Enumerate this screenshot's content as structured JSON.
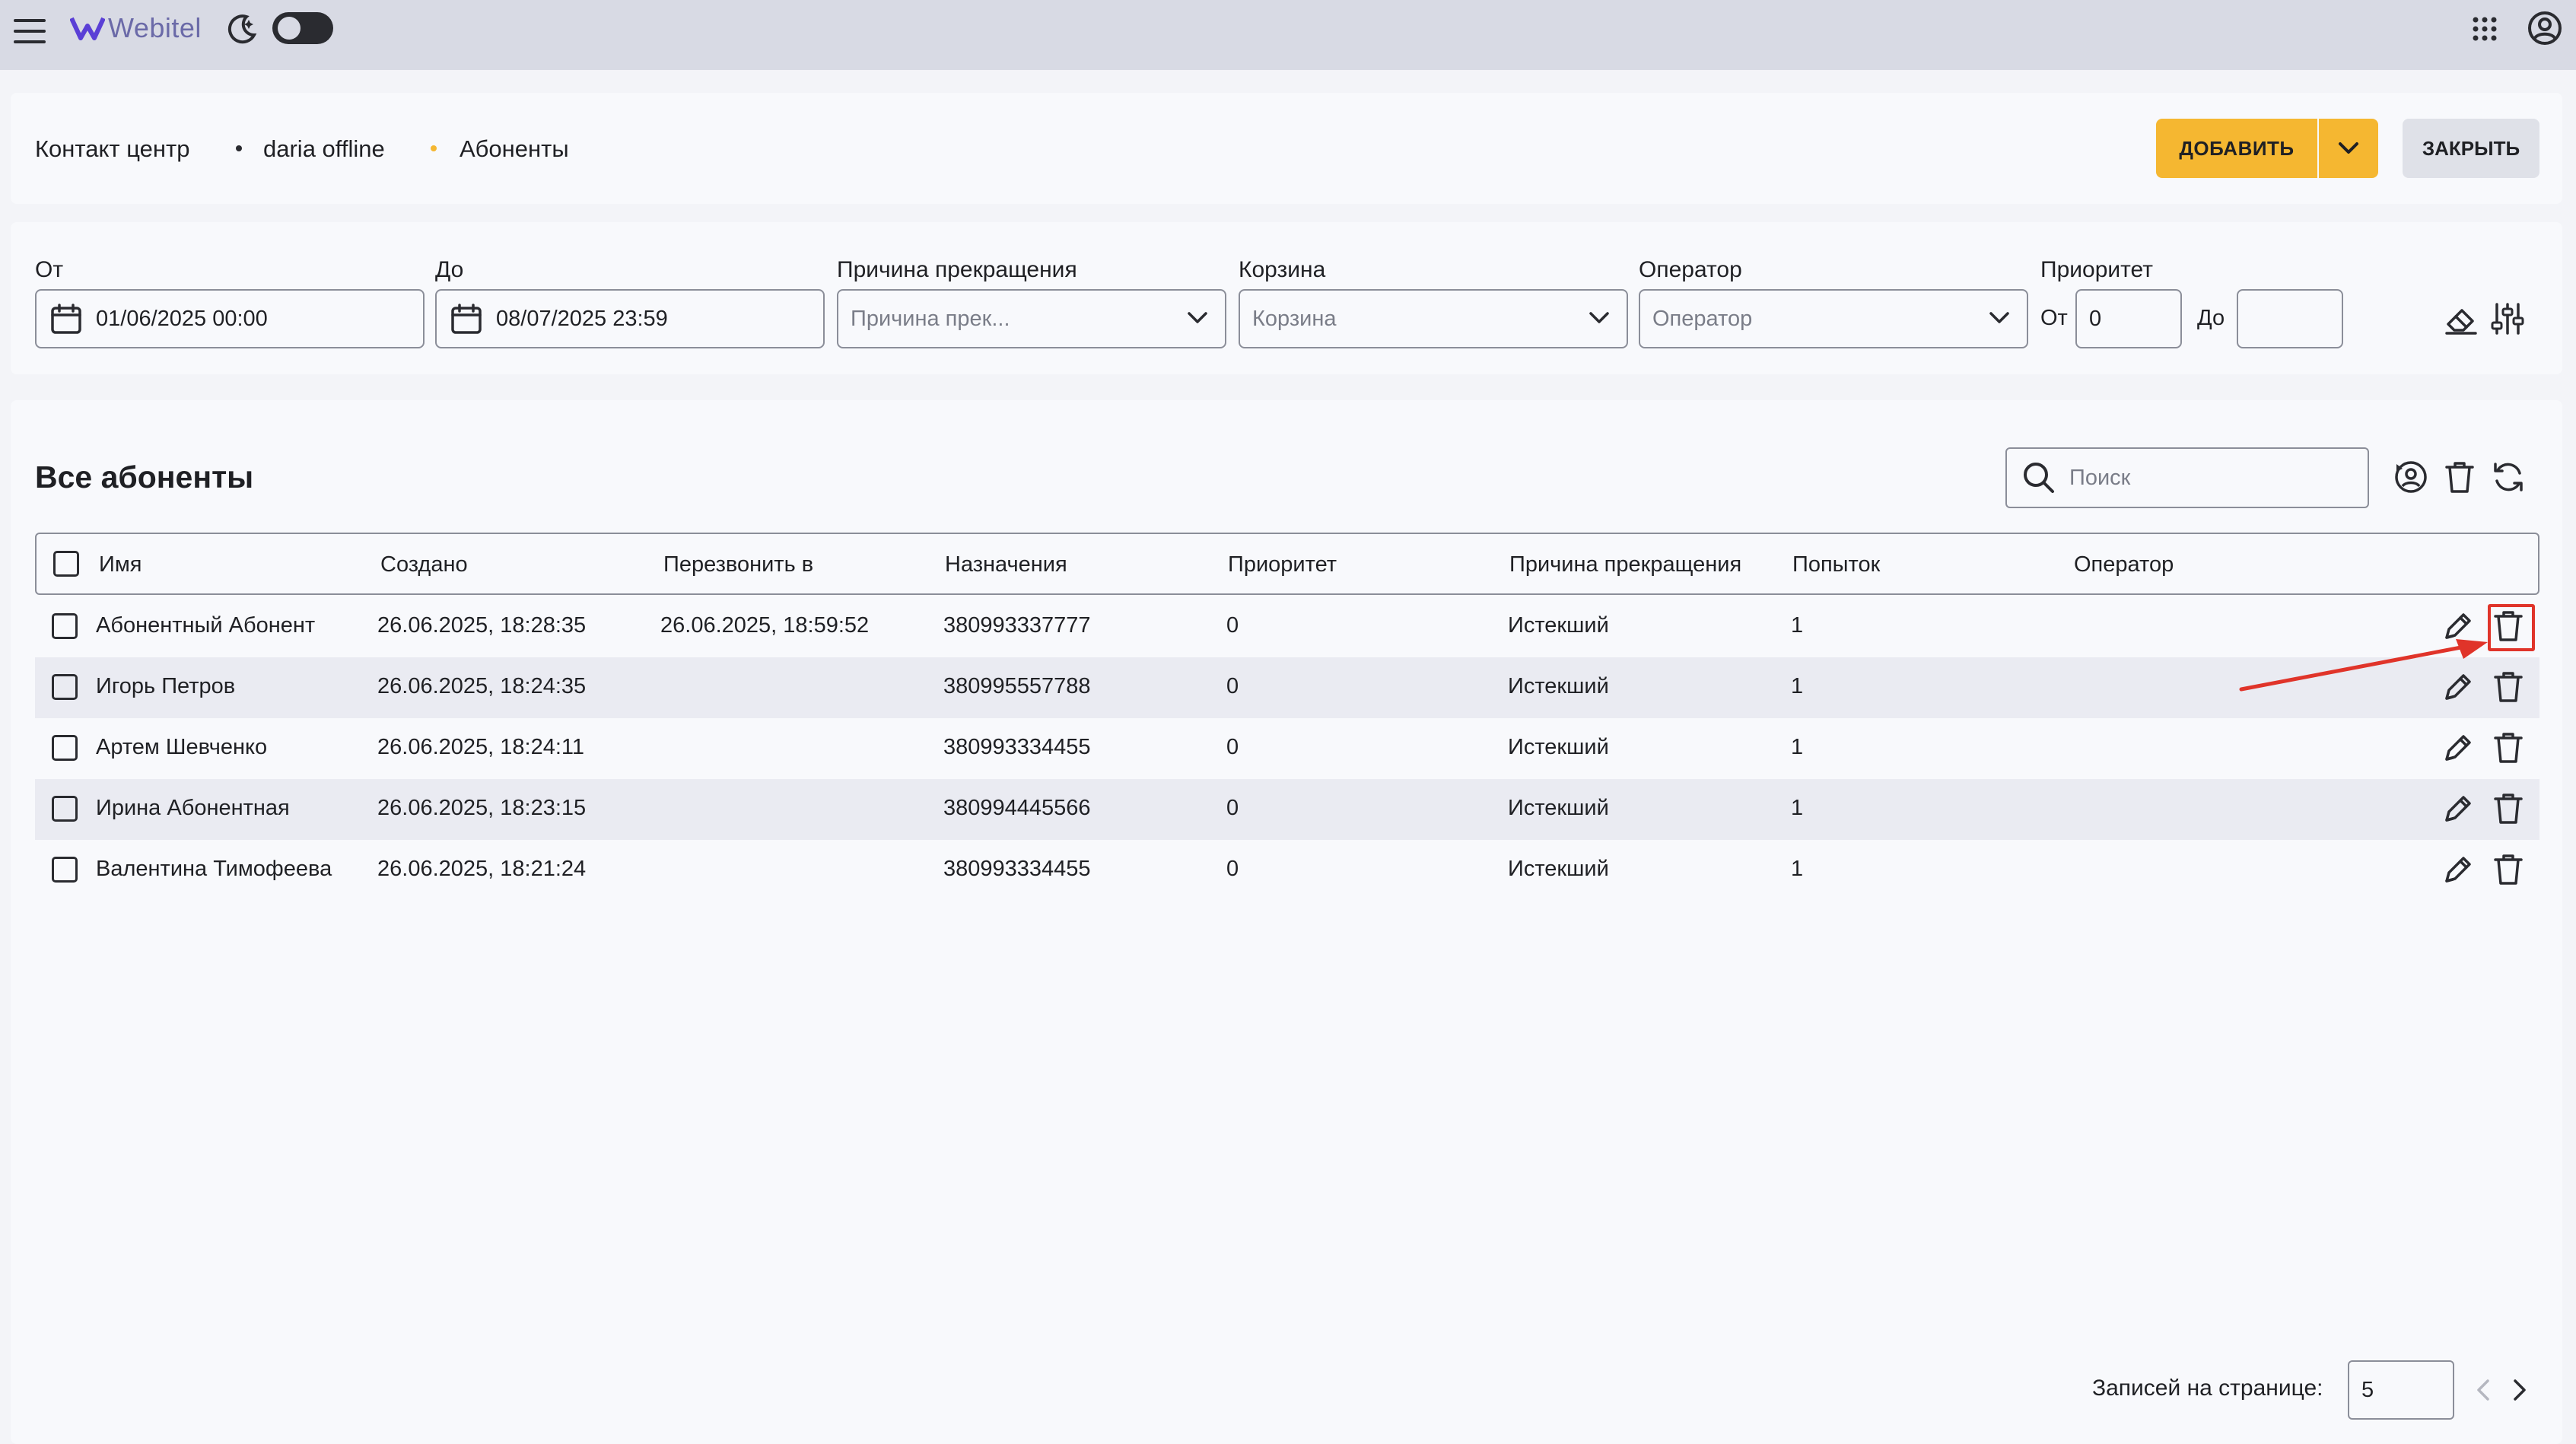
{
  "topbar": {
    "app_name": "Webitel",
    "icons": [
      "menu-icon",
      "logo-icon",
      "theme-moon-icon",
      "theme-toggle",
      "apps-grid-icon",
      "account-icon"
    ]
  },
  "breadcrumb": {
    "items": [
      "Контакт центр",
      "daria offline",
      "Абоненты"
    ]
  },
  "actions": {
    "add_label": "ДОБАВИТЬ",
    "close_label": "ЗАКРЫТЬ"
  },
  "filters": {
    "from_label": "От",
    "from_value": "01/06/2025 00:00",
    "to_label": "До",
    "to_value": "08/07/2025 23:59",
    "reason_label": "Причина прекращения",
    "reason_placeholder": "Причина прек...",
    "bucket_label": "Корзина",
    "bucket_placeholder": "Корзина",
    "operator_label": "Оператор",
    "operator_placeholder": "Оператор",
    "priority_label": "Приоритет",
    "priority_from_label": "От",
    "priority_from_value": "0",
    "priority_to_label": "До",
    "priority_to_value": ""
  },
  "table": {
    "title": "Все абоненты",
    "search_placeholder": "Поиск",
    "columns": [
      "Имя",
      "Создано",
      "Перезвонить в",
      "Назначения",
      "Приоритет",
      "Причина прекращения",
      "Попыток",
      "Оператор"
    ],
    "rows": [
      {
        "name": "Абонентный Абонент",
        "created": "26.06.2025, 18:28:35",
        "callback": "26.06.2025, 18:59:52",
        "destination": "380993337777",
        "priority": "0",
        "reason": "Истекший",
        "attempts": "1",
        "operator": ""
      },
      {
        "name": "Игорь Петров",
        "created": "26.06.2025, 18:24:35",
        "callback": "",
        "destination": "380995557788",
        "priority": "0",
        "reason": "Истекший",
        "attempts": "1",
        "operator": ""
      },
      {
        "name": "Артем Шевченко",
        "created": "26.06.2025, 18:24:11",
        "callback": "",
        "destination": "380993334455",
        "priority": "0",
        "reason": "Истекший",
        "attempts": "1",
        "operator": ""
      },
      {
        "name": "Ирина Абонентная",
        "created": "26.06.2025, 18:23:15",
        "callback": "",
        "destination": "380994445566",
        "priority": "0",
        "reason": "Истекший",
        "attempts": "1",
        "operator": ""
      },
      {
        "name": "Валентина Тимофеева",
        "created": "26.06.2025, 18:21:24",
        "callback": "",
        "destination": "380993334455",
        "priority": "0",
        "reason": "Истекший",
        "attempts": "1",
        "operator": ""
      }
    ]
  },
  "pagination": {
    "per_page_label": "Записей на странице:",
    "per_page_value": "5"
  },
  "colors": {
    "accent": "#f5b731",
    "highlight": "#e0342a",
    "topbar": "#d8dae4"
  }
}
